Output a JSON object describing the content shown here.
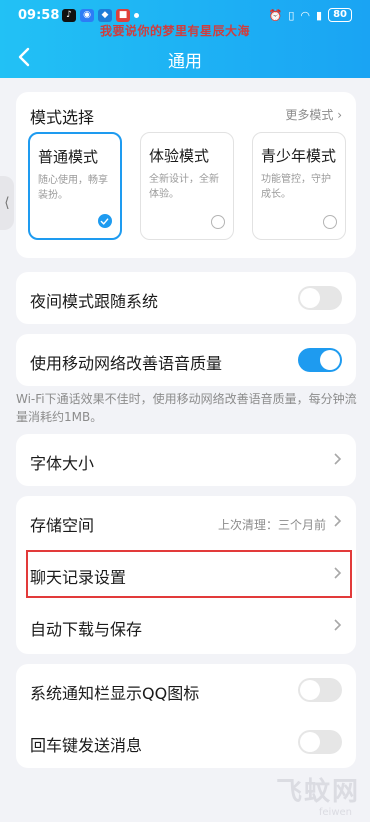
{
  "status_bar": {
    "time": "09:58",
    "battery": "80"
  },
  "overlay_text": "我要说你的梦里有星辰大海",
  "header": {
    "title": "通用"
  },
  "mode_section": {
    "title": "模式选择",
    "more_label": "更多模式",
    "modes": [
      {
        "name": "普通模式",
        "desc": "随心使用，畅享装扮。",
        "selected": true
      },
      {
        "name": "体验模式",
        "desc": "全新设计，全新体验。",
        "selected": false
      },
      {
        "name": "青少年模式",
        "desc": "功能管控，守护成长。",
        "selected": false
      }
    ]
  },
  "settings": {
    "night_mode": "夜间模式跟随系统",
    "mobile_voice": "使用移动网络改善语音质量",
    "mobile_voice_note": "Wi-Fi下通话效果不佳时，使用移动网络改善语音质量，每分钟流量消耗约1MB。",
    "font_size": "字体大小",
    "storage": "存储空间",
    "storage_value": "上次清理：三个月前",
    "chat_history": "聊天记录设置",
    "auto_download": "自动下载与保存",
    "qq_icon": "系统通知栏显示QQ图标",
    "enter_send": "回车键发送消息"
  },
  "watermark": {
    "main": "飞蚊网",
    "sub": "feiwen"
  }
}
